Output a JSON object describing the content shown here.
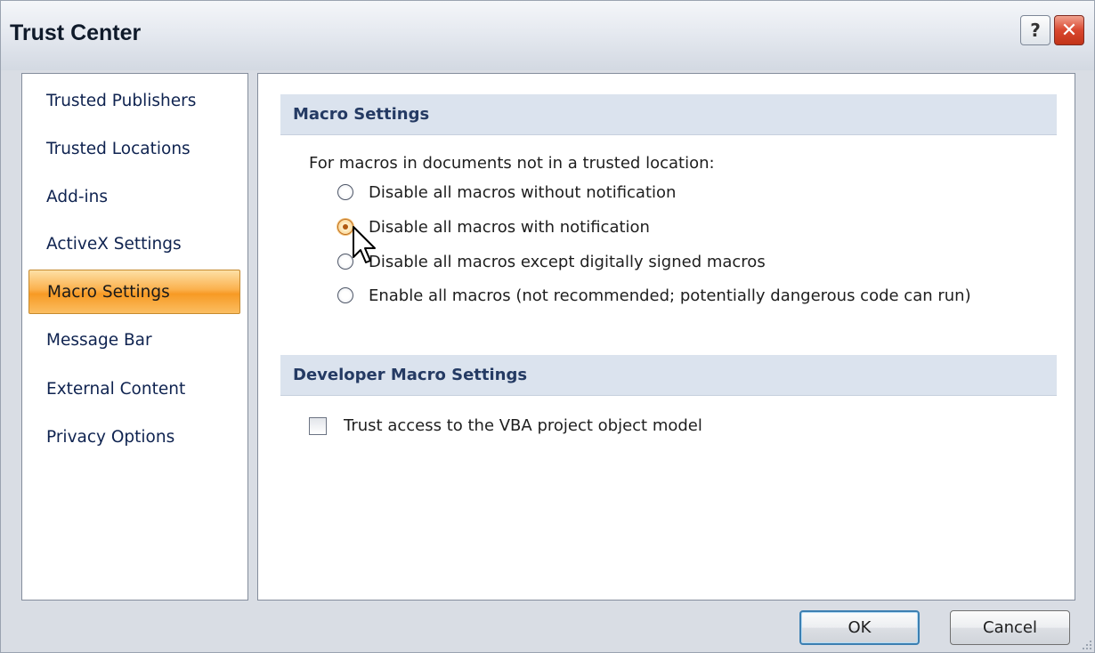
{
  "window": {
    "title": "Trust Center",
    "help_label": "?",
    "close_label": "✕"
  },
  "nav": {
    "items": [
      {
        "label": "Trusted Publishers"
      },
      {
        "label": "Trusted Locations"
      },
      {
        "label": "Add-ins"
      },
      {
        "label": "ActiveX Settings"
      },
      {
        "label": "Macro Settings",
        "selected": true
      },
      {
        "label": "Message Bar"
      },
      {
        "label": "External Content"
      },
      {
        "label": "Privacy Options"
      }
    ]
  },
  "macro": {
    "header": "Macro Settings",
    "intro": "For macros in documents not in a trusted location:",
    "options": [
      {
        "label": "Disable all macros without notification",
        "checked": false
      },
      {
        "label": "Disable all macros with notification",
        "checked": true
      },
      {
        "label": "Disable all macros except digitally signed macros",
        "checked": false
      },
      {
        "label": "Enable all macros (not recommended; potentially dangerous code can run)",
        "checked": false
      }
    ]
  },
  "developer": {
    "header": "Developer Macro Settings",
    "vba_label": "Trust access to the VBA project object model",
    "vba_checked": false
  },
  "buttons": {
    "ok": "OK",
    "cancel": "Cancel"
  },
  "colors": {
    "selected_nav": "#f79a24",
    "section_header_bg": "#dbe3ee",
    "section_header_text": "#243a63",
    "close_button": "#d9472f"
  }
}
